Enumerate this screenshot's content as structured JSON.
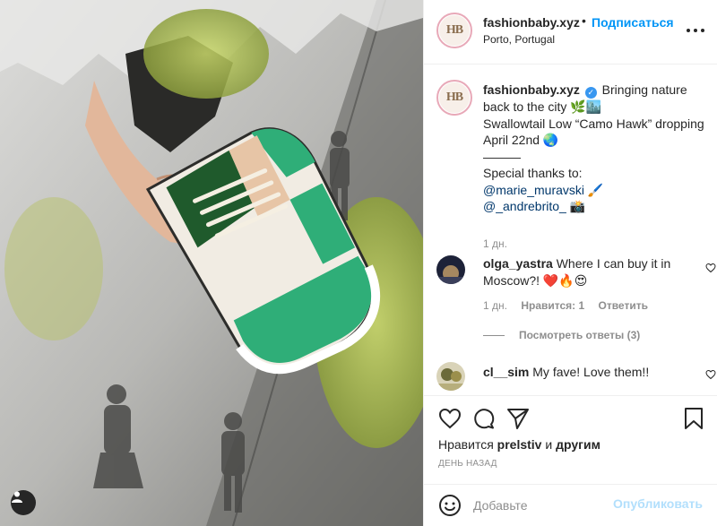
{
  "post": {
    "image_alt": "Sneaker emerging from torn wall",
    "user_tag_icon": "user-icon"
  },
  "header": {
    "username": "fashionbaby.xyz",
    "avatar_text": "HB",
    "dot": "•",
    "follow_label": "Подписаться",
    "location": "Porto, Portugal",
    "more_icon": "more-horizontal-icon"
  },
  "caption": {
    "username": "fashionbaby.xyz",
    "avatar_text": "HB",
    "line1": "Bringing nature back to the city 🌿🏙️",
    "line2": "Swallowtail Low “Camo Hawk” dropping April 22nd 🌏",
    "line3": "———",
    "line4": "Special thanks to:",
    "mention1": "@marie_muravski",
    "mention1_emoji": "🖌️",
    "mention2": "@_andrebrito_",
    "mention2_emoji": "📸",
    "time": "1 дн."
  },
  "comments": [
    {
      "username": "olga_yastra",
      "text": "Where I can buy it in Moscow?! ❤️🔥😍",
      "time": "1 дн.",
      "replies_label": "Нравится: 1",
      "reply_label": "Ответить",
      "view_replies": "Посмотреть ответы (3)"
    },
    {
      "username": "cl__sim",
      "text": "My fave! Love them!!"
    }
  ],
  "actions": {
    "liked_prefix": "Нравится",
    "liked_user": "prelstiv",
    "liked_and": "и",
    "liked_others": "другим",
    "posted": "ДЕНЬ НАЗАД"
  },
  "add_comment": {
    "placeholder": "Добавьте",
    "publish_label": "Опубликовать"
  },
  "colors": {
    "accent": "#0095f6",
    "publish_disabled": "#b2dffc",
    "secondary_text": "#8e8e8e",
    "shoe_green": "#2fae78",
    "shoe_dark_green": "#1f5a2c"
  }
}
